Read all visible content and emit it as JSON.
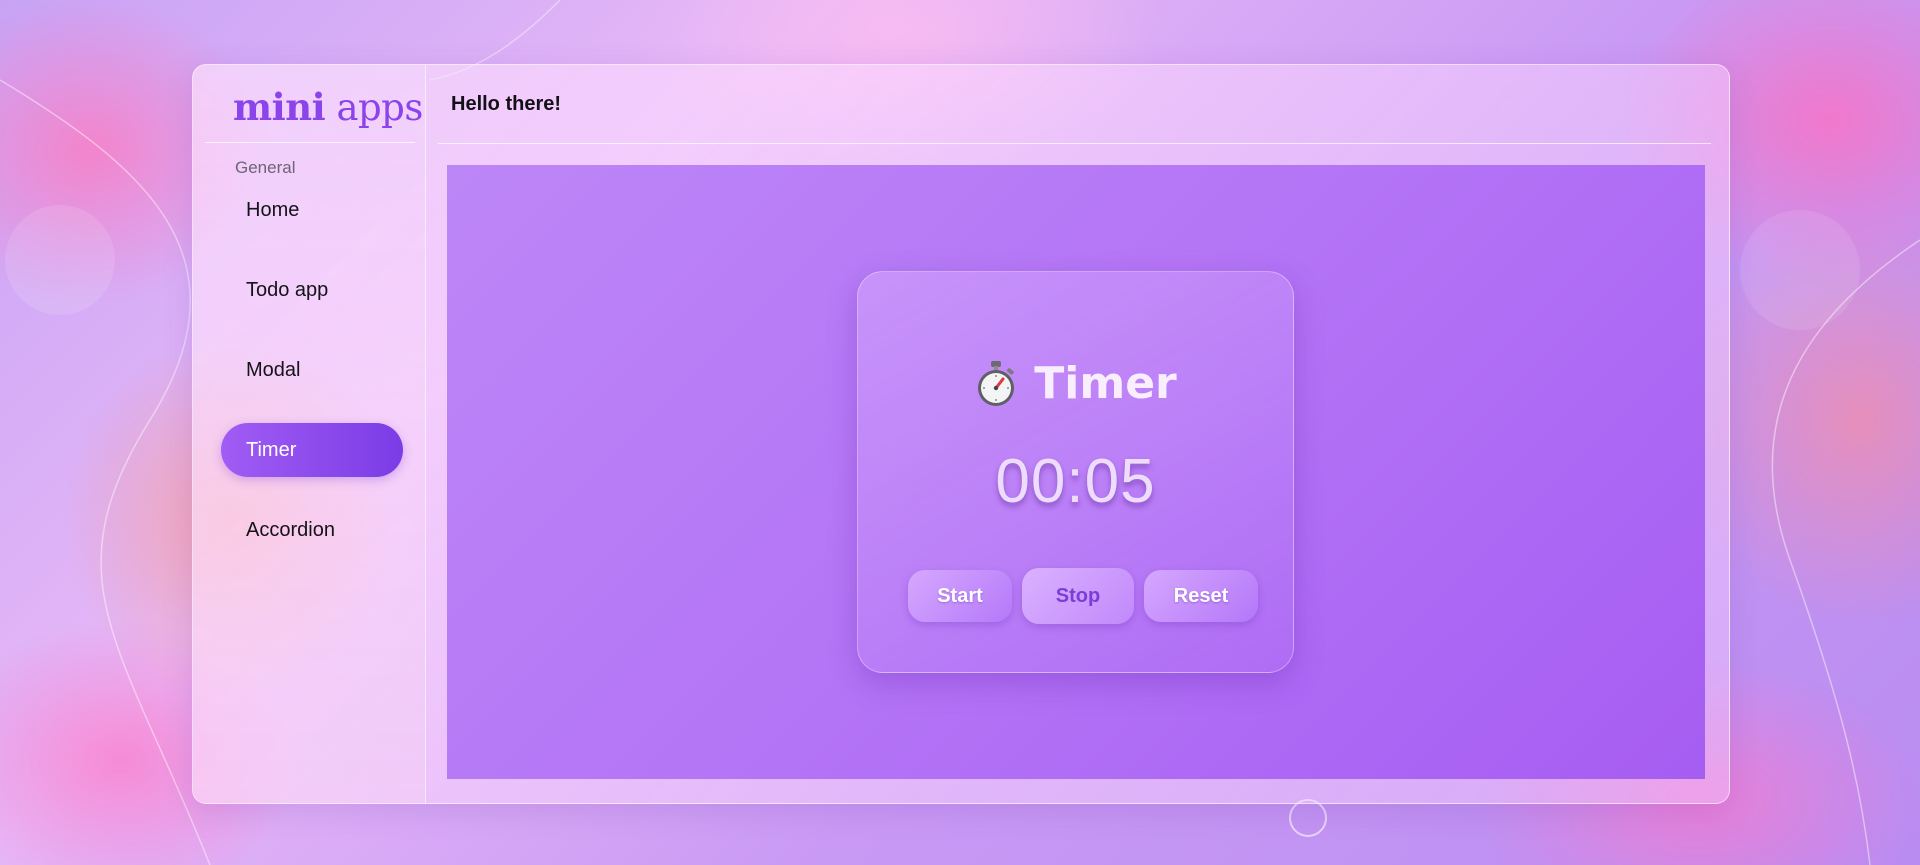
{
  "app": {
    "logo_bold": "mini",
    "logo_rest": "apps"
  },
  "sidebar": {
    "section_label": "General",
    "items": [
      {
        "label": "Home",
        "active": false
      },
      {
        "label": "Todo app",
        "active": false
      },
      {
        "label": "Modal",
        "active": false
      },
      {
        "label": "Timer",
        "active": true
      },
      {
        "label": "Accordion",
        "active": false
      }
    ]
  },
  "header": {
    "greeting": "Hello there!"
  },
  "timer": {
    "icon": "stopwatch-icon",
    "title": "Timer",
    "time": "00:05",
    "buttons": {
      "start": "Start",
      "stop": "Stop",
      "reset": "Reset"
    }
  },
  "colors": {
    "accent": "#8b43ea",
    "active_nav_start": "#a15cf4",
    "active_nav_end": "#7b3ce6",
    "panel_background": "#b474f6"
  }
}
